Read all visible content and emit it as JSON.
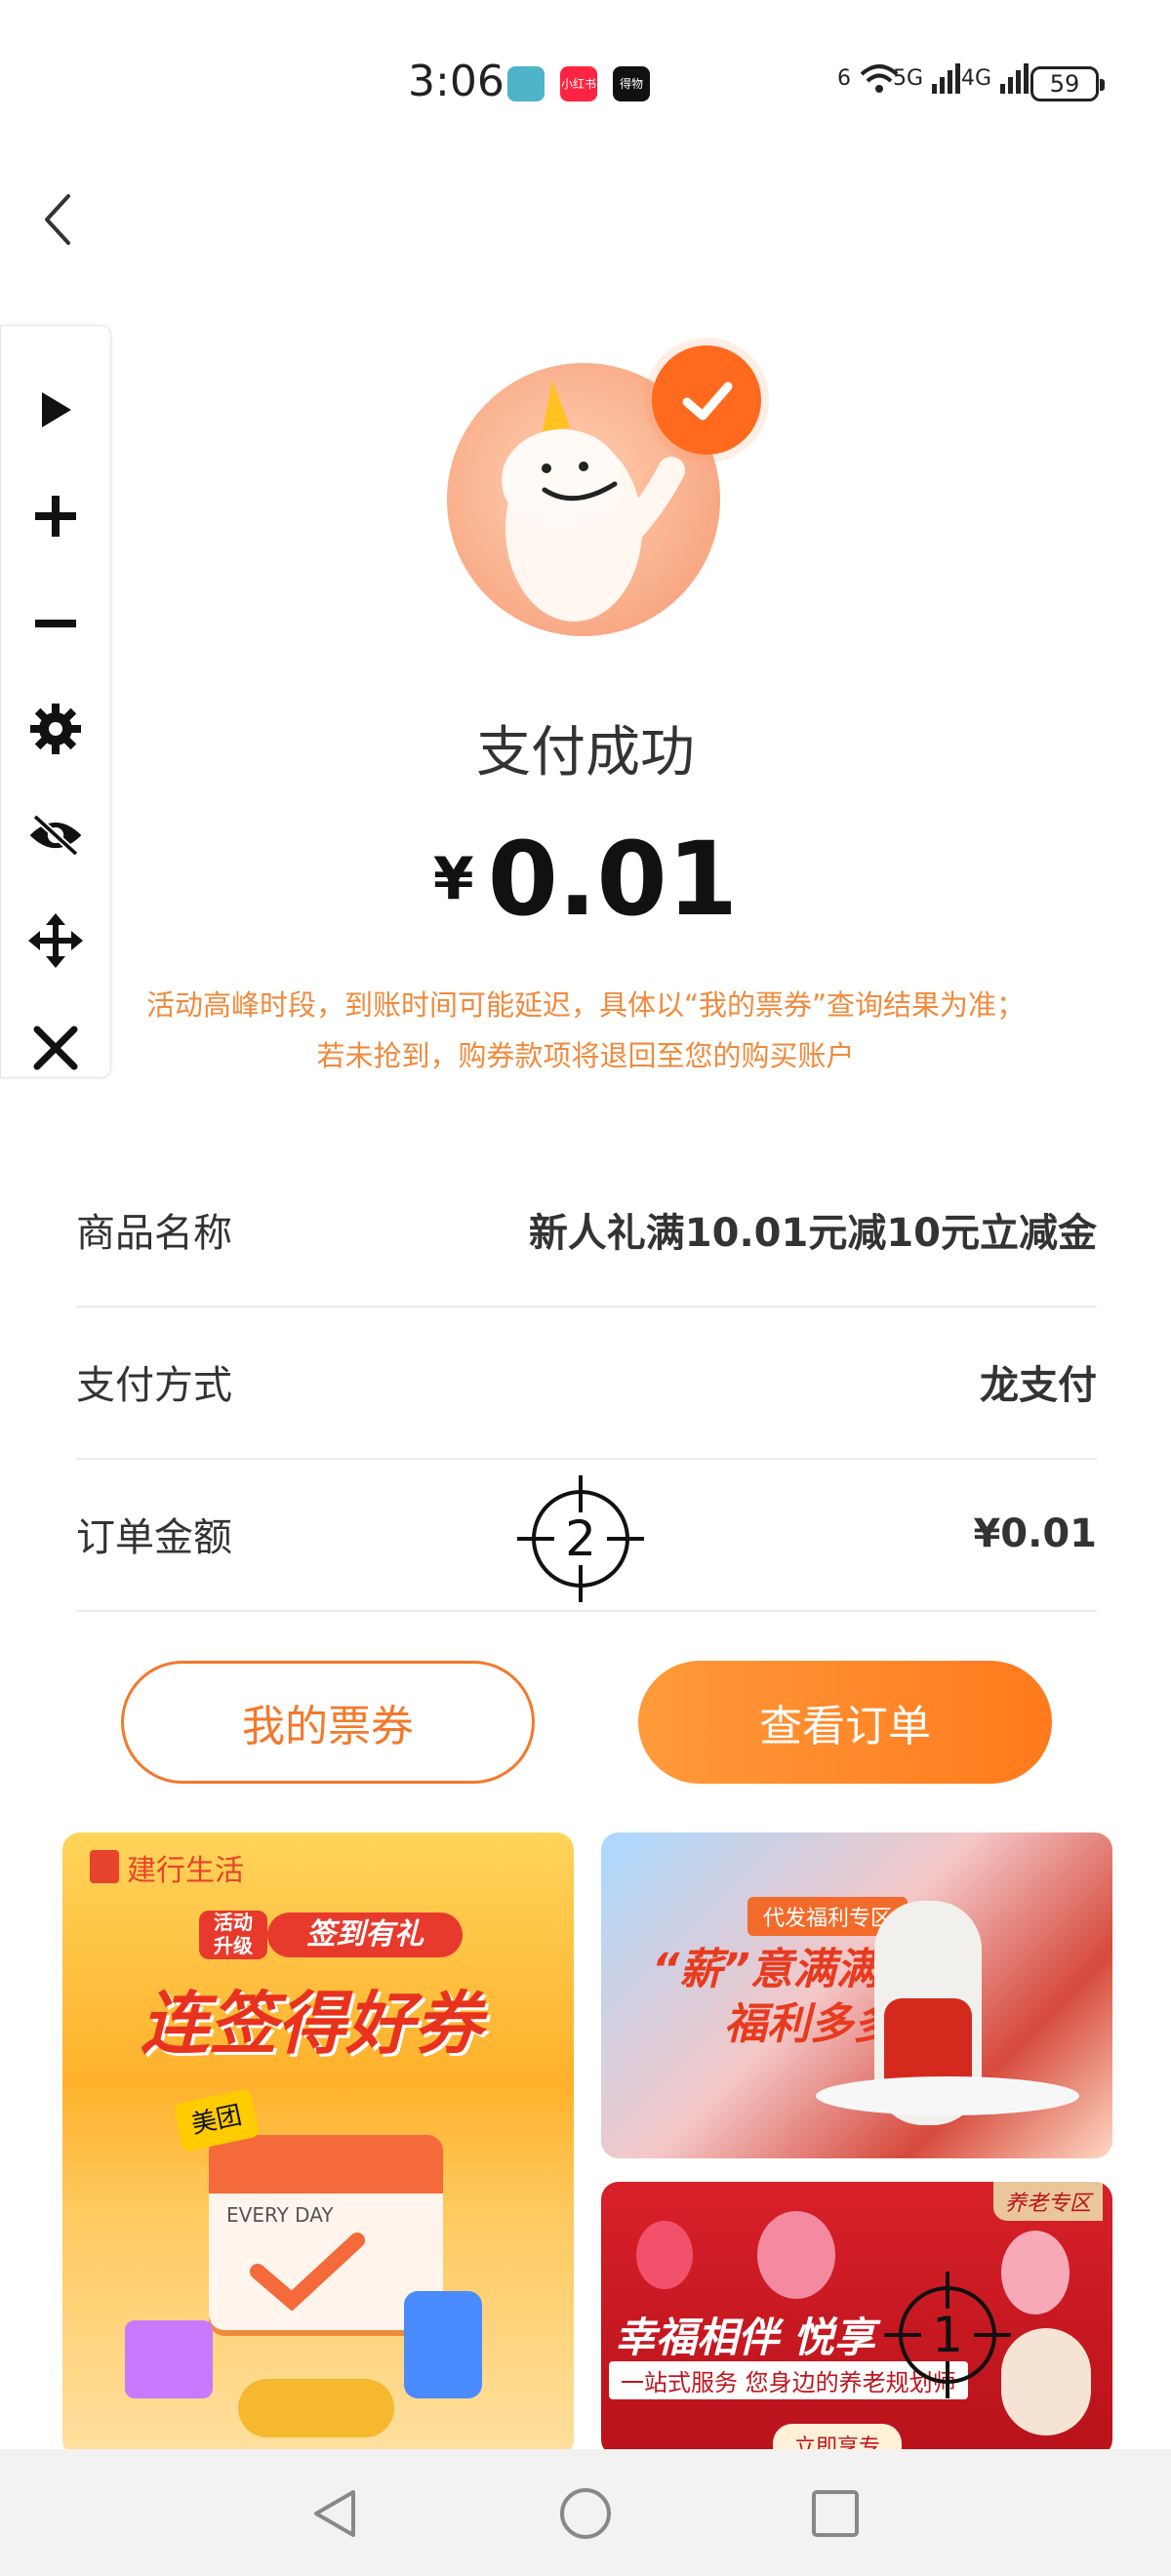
{
  "status_bar": {
    "time": "3:06",
    "app_badges": [
      "",
      "小红书",
      "得物"
    ],
    "net_labels": [
      "6",
      "5G",
      "4G"
    ],
    "battery": "59"
  },
  "toolbar": {
    "icons": [
      "play-icon",
      "plus-icon",
      "minus-icon",
      "gear-icon",
      "eye-off-icon",
      "move-icon",
      "close-icon"
    ]
  },
  "payment": {
    "title": "支付成功",
    "currency": "¥",
    "amount": "0.01",
    "notice_line1": "活动高峰时段，到账时间可能延迟，具体以“我的票券”查询结果为准；",
    "notice_line2": "若未抢到，购券款项将退回至您的购买账户"
  },
  "details": [
    {
      "label": "商品名称",
      "value": "新人礼满10.01元减10元立减金"
    },
    {
      "label": "支付方式",
      "value": "龙支付"
    },
    {
      "label": "订单金额",
      "value": "¥0.01"
    }
  ],
  "buttons": {
    "my_tickets": "我的票券",
    "view_order": "查看订单"
  },
  "markers": [
    "2",
    "1"
  ],
  "banners": {
    "left": {
      "brand": "建行生活",
      "tag1": "活动",
      "tag2": "升级",
      "pill": "签到有礼",
      "headline": "连签得好券",
      "calendar": "EVERY DAY",
      "meituan": "美团"
    },
    "right_top": {
      "tag": "代发福利专区",
      "line1": "“薪”意满满",
      "line2": "福利多多"
    },
    "right_bottom": {
      "corner": "养老专区",
      "headline": "幸福相伴 悦享",
      "sub": "一站式服务 您身边的养老规划师",
      "cta": "立即享专"
    }
  },
  "colors": {
    "accent": "#f3792b",
    "notice": "#f08a3c"
  }
}
